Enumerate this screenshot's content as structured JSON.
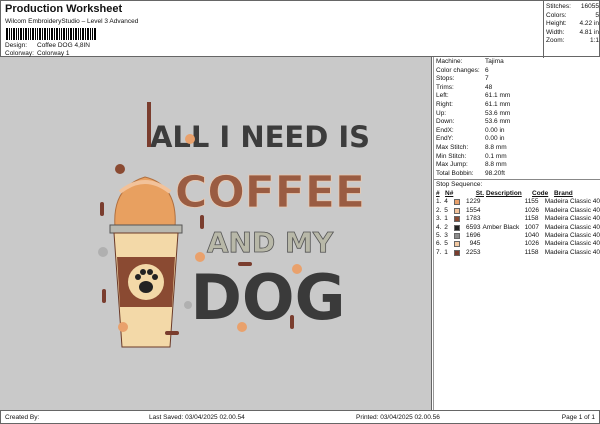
{
  "header": {
    "title": "Production Worksheet",
    "subtitle": "Wilcom EmbroideryStudio – Level 3 Advanced",
    "design_label": "Design:",
    "design_value": "Coffee DOG 4,8IN",
    "colorway_label": "Colorway:",
    "colorway_value": "Colorway 1"
  },
  "stats": [
    {
      "label": "Stitches:",
      "value": "16055"
    },
    {
      "label": "Colors:",
      "value": "5"
    },
    {
      "label": "Height:",
      "value": "4.22 in"
    },
    {
      "label": "Width:",
      "value": "4.81 in"
    },
    {
      "label": "Zoom:",
      "value": "1:1"
    }
  ],
  "artwork": {
    "line1": "ALL I NEED IS",
    "line2": "COFFEE",
    "line3": "AND MY",
    "line4": "DOG"
  },
  "machine_info": [
    {
      "label": "Machine:",
      "value": "Tajima"
    },
    {
      "label": "Color changes:",
      "value": "6"
    },
    {
      "label": "Stops:",
      "value": "7"
    },
    {
      "label": "Trims:",
      "value": "48"
    },
    {
      "label": "Left:",
      "value": "61.1 mm"
    },
    {
      "label": "Right:",
      "value": "61.1 mm"
    },
    {
      "label": "Up:",
      "value": "53.6 mm"
    },
    {
      "label": "Down:",
      "value": "53.6 mm"
    },
    {
      "label": "EndX:",
      "value": "0.00 in"
    },
    {
      "label": "EndY:",
      "value": "0.00 in"
    },
    {
      "label": "Max Stitch:",
      "value": "8.8 mm"
    },
    {
      "label": "Min Stitch:",
      "value": "0.1 mm"
    },
    {
      "label": "Max Jump:",
      "value": "8.8 mm"
    },
    {
      "label": "Total Bobbin:",
      "value": "98.20ft"
    }
  ],
  "stop_sequence": {
    "title": "Stop Sequence:",
    "headers": [
      "#",
      "N#",
      "St.",
      "Description",
      "Code",
      "Brand"
    ],
    "rows": [
      {
        "n": "1.",
        "nn": "4",
        "color": "#e9a16c",
        "st": "1229",
        "desc": "",
        "code": "1155",
        "brand": "Madeira Classic 40"
      },
      {
        "n": "2.",
        "nn": "5",
        "color": "#f2c29a",
        "st": "1554",
        "desc": "",
        "code": "1026",
        "brand": "Madeira Classic 40"
      },
      {
        "n": "3.",
        "nn": "1",
        "color": "#8a4a32",
        "st": "1783",
        "desc": "",
        "code": "1158",
        "brand": "Madeira Classic 40"
      },
      {
        "n": "4.",
        "nn": "2",
        "color": "#222222",
        "st": "6593",
        "desc": "Amber Black",
        "code": "1007",
        "brand": "Madeira Classic 40"
      },
      {
        "n": "5.",
        "nn": "3",
        "color": "#8c8c8c",
        "st": "1696",
        "desc": "",
        "code": "1040",
        "brand": "Madeira Classic 40"
      },
      {
        "n": "6.",
        "nn": "5",
        "color": "#f3c9a2",
        "st": "945",
        "desc": "",
        "code": "1026",
        "brand": "Madeira Classic 40"
      },
      {
        "n": "7.",
        "nn": "1",
        "color": "#7a3d2e",
        "st": "2253",
        "desc": "",
        "code": "1158",
        "brand": "Madeira Classic 40"
      }
    ]
  },
  "footer": {
    "created": "Created By:",
    "saved": "Last Saved: 03/04/2025 02.00.54",
    "printed": "Printed: 03/04/2025 02.00.56",
    "page": "Page 1 of 1"
  }
}
